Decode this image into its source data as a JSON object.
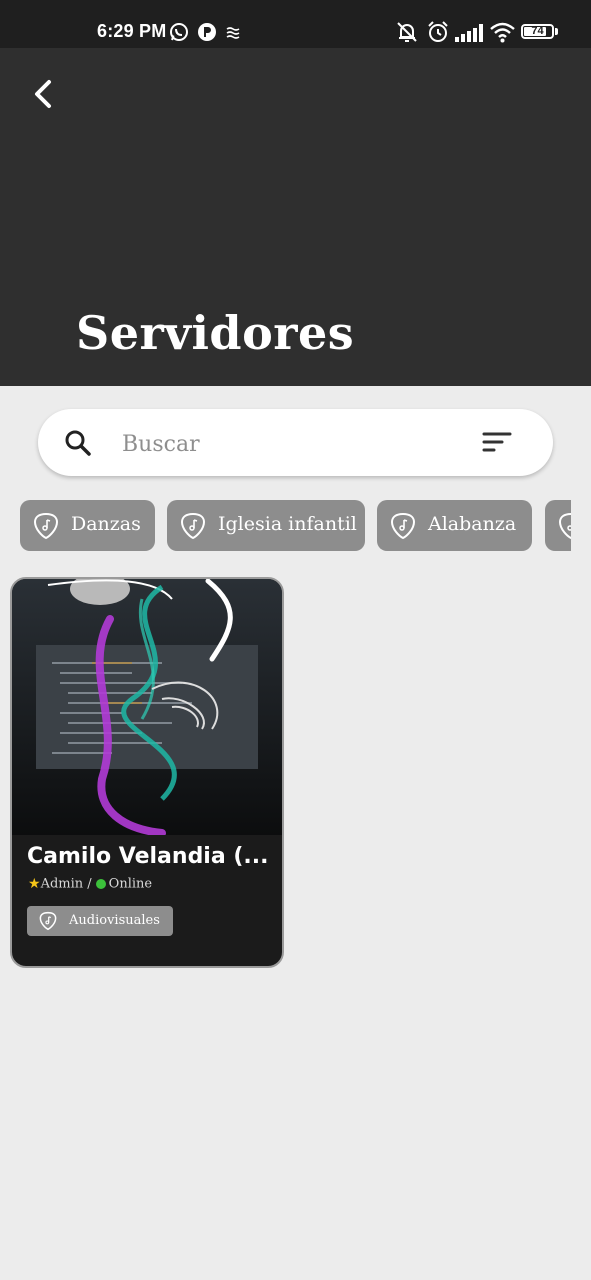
{
  "status_bar": {
    "time": "6:29 PM",
    "battery": "74",
    "icons": [
      "whatsapp-icon",
      "app-icon",
      "data-saver-icon",
      "mute-icon",
      "alarm-icon",
      "signal-icon",
      "wifi-icon",
      "battery-icon"
    ]
  },
  "header": {
    "title": "Servidores",
    "back_icon": "chevron-left-icon",
    "background": "#2f2f2f"
  },
  "search": {
    "placeholder": "Buscar",
    "value": "",
    "icon": "search-icon",
    "filter_icon": "sort-icon"
  },
  "filters": [
    {
      "label": "Danzas",
      "icon": "guitar-pick-icon"
    },
    {
      "label": "Iglesia infantil",
      "icon": "guitar-pick-icon"
    },
    {
      "label": "Alabanza",
      "icon": "guitar-pick-icon"
    }
  ],
  "members": [
    {
      "name": "Camilo Velandia (...",
      "role": "Admin",
      "separator": "/",
      "status": "Online",
      "status_color": "#3cc13b",
      "ministry": "Audiovisuales"
    }
  ],
  "colors": {
    "background": "#ececec",
    "chip": "#8d8d8d",
    "card": "#1b1b1b"
  }
}
